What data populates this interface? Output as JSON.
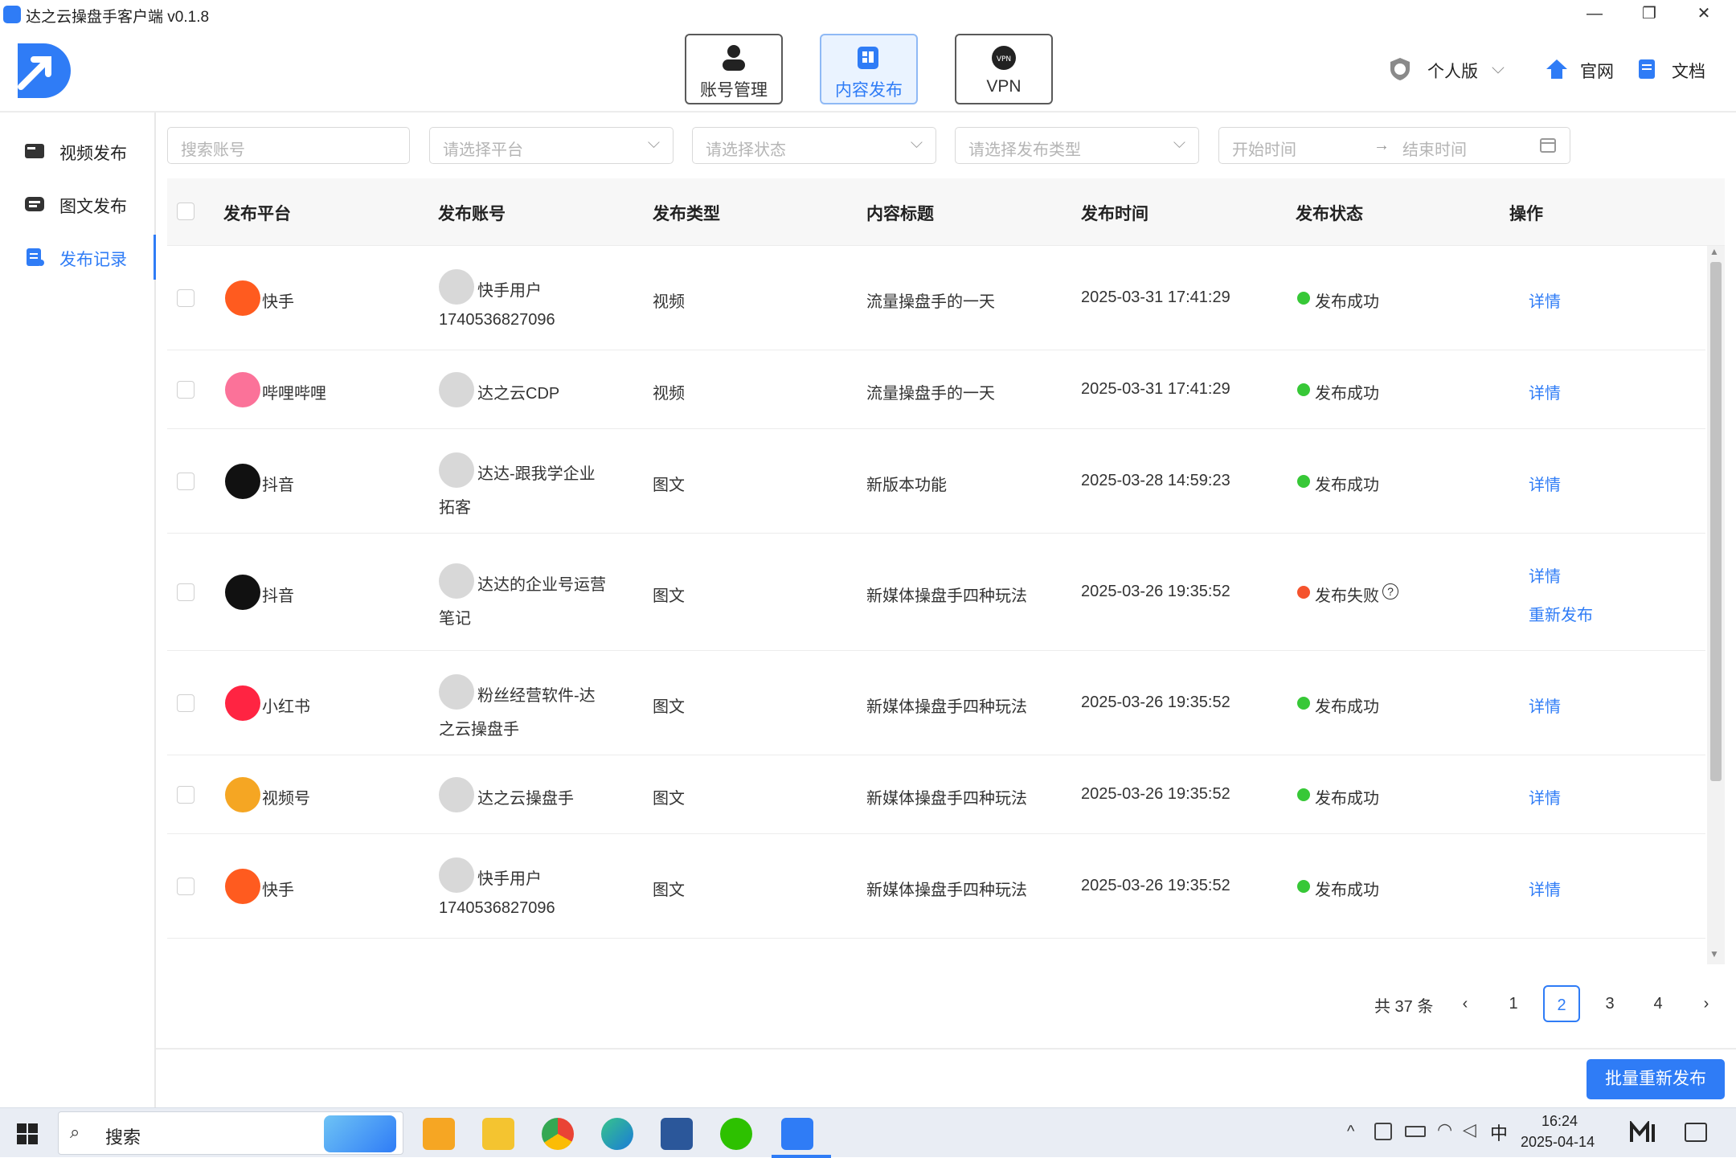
{
  "window": {
    "title": "达之云操盘手客户端 v0.1.8",
    "controls": [
      "—",
      "❐",
      "✕"
    ]
  },
  "header": {
    "nav": [
      {
        "label": "账号管理",
        "icon": "user-icon",
        "active": false
      },
      {
        "label": "内容发布",
        "icon": "publish-icon",
        "active": true
      },
      {
        "label": "VPN",
        "icon": "vpn-icon",
        "active": false
      }
    ],
    "edition": "个人版",
    "site": "官网",
    "docs": "文档"
  },
  "sidebar": {
    "items": [
      {
        "label": "视频发布",
        "active": false
      },
      {
        "label": "图文发布",
        "active": false
      },
      {
        "label": "发布记录",
        "active": true
      }
    ]
  },
  "filters": {
    "search_placeholder": "搜索账号",
    "platform_placeholder": "请选择平台",
    "status_placeholder": "请选择状态",
    "type_placeholder": "请选择发布类型",
    "start_placeholder": "开始时间",
    "end_placeholder": "结束时间",
    "arrow": "→"
  },
  "table": {
    "columns": [
      "发布平台",
      "发布账号",
      "发布类型",
      "内容标题",
      "发布时间",
      "发布状态",
      "操作"
    ],
    "rows": [
      {
        "platform": "快手",
        "pcolor": "#ff5b1f",
        "account": "快手用户",
        "account2": "1740536827096",
        "type": "视频",
        "title": "流量操盘手的一天",
        "time": "2025-03-31 17:41:29",
        "status": "发布成功",
        "ok": true,
        "actions": [
          "详情"
        ]
      },
      {
        "platform": "哔哩哔哩",
        "pcolor": "#fb7299",
        "account": "达之云CDP",
        "account2": "",
        "type": "视频",
        "title": "流量操盘手的一天",
        "time": "2025-03-31 17:41:29",
        "status": "发布成功",
        "ok": true,
        "actions": [
          "详情"
        ]
      },
      {
        "platform": "抖音",
        "pcolor": "#111111",
        "account": "达达-跟我学企业",
        "account2": "拓客",
        "type": "图文",
        "title": "新版本功能",
        "time": "2025-03-28 14:59:23",
        "status": "发布成功",
        "ok": true,
        "actions": [
          "详情"
        ]
      },
      {
        "platform": "抖音",
        "pcolor": "#111111",
        "account": "达达的企业号运营",
        "account2": "笔记",
        "type": "图文",
        "title": "新媒体操盘手四种玩法",
        "time": "2025-03-26 19:35:52",
        "status": "发布失败",
        "ok": false,
        "actions": [
          "详情",
          "重新发布"
        ]
      },
      {
        "platform": "小红书",
        "pcolor": "#ff2442",
        "account": "粉丝经营软件-达",
        "account2": "之云操盘手",
        "type": "图文",
        "title": "新媒体操盘手四种玩法",
        "time": "2025-03-26 19:35:52",
        "status": "发布成功",
        "ok": true,
        "actions": [
          "详情"
        ]
      },
      {
        "platform": "视频号",
        "pcolor": "#f5a623",
        "account": "达之云操盘手",
        "account2": "",
        "type": "图文",
        "title": "新媒体操盘手四种玩法",
        "time": "2025-03-26 19:35:52",
        "status": "发布成功",
        "ok": true,
        "actions": [
          "详情"
        ]
      },
      {
        "platform": "快手",
        "pcolor": "#ff5b1f",
        "account": "快手用户",
        "account2": "1740536827096",
        "type": "图文",
        "title": "新媒体操盘手四种玩法",
        "time": "2025-03-26 19:35:52",
        "status": "发布成功",
        "ok": true,
        "actions": [
          "详情"
        ]
      }
    ]
  },
  "pagination": {
    "total": "共 37 条",
    "pages": [
      "1",
      "2",
      "3",
      "4"
    ],
    "current": "2"
  },
  "bulk_button": "批量重新发布",
  "taskbar": {
    "search": "搜索",
    "lang": "中",
    "time": "16:24",
    "date": "2025-04-14"
  }
}
